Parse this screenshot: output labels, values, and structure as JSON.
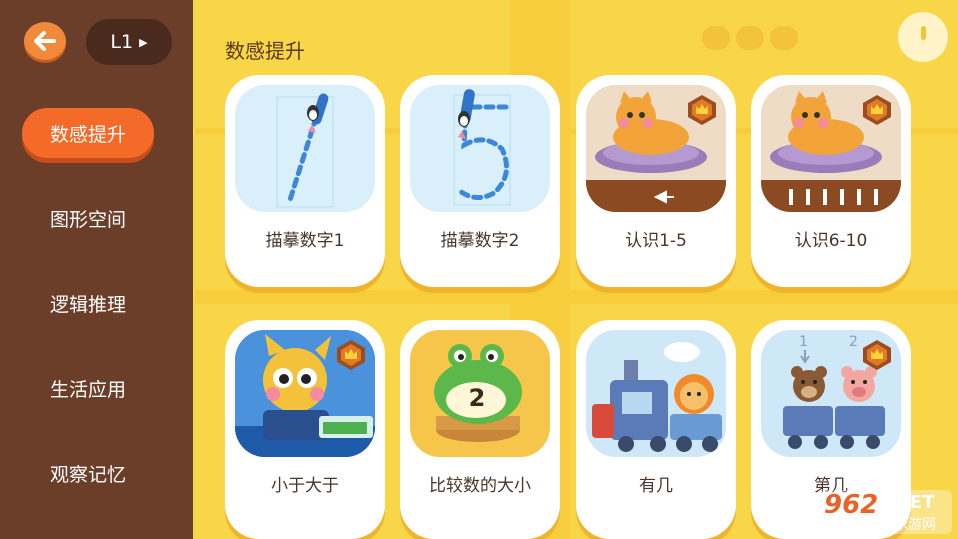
{
  "header": {
    "level_label": "L1",
    "section_title": "数感提升"
  },
  "sidebar": {
    "items": [
      {
        "label": "数感提升",
        "active": true
      },
      {
        "label": "图形空间",
        "active": false
      },
      {
        "label": "逻辑推理",
        "active": false
      },
      {
        "label": "生活应用",
        "active": false
      },
      {
        "label": "观察记忆",
        "active": false
      }
    ]
  },
  "lessons": [
    {
      "label": "描摹数字1",
      "icon": "trace-number-one-icon"
    },
    {
      "label": "描摹数字2",
      "icon": "trace-number-five-icon"
    },
    {
      "label": "认识1-5",
      "icon": "cat-fish-icon",
      "premium": true
    },
    {
      "label": "认识6-10",
      "icon": "cat-fish-icon",
      "premium": true
    },
    {
      "label": "小于大于",
      "icon": "fox-scale-icon",
      "premium": true
    },
    {
      "label": "比较数的大小",
      "icon": "frog-number-icon",
      "number": "2"
    },
    {
      "label": "有几",
      "icon": "train-lion-icon"
    },
    {
      "label": "第几",
      "icon": "train-bears-icon",
      "premium": true,
      "numbers": [
        "1",
        "2"
      ]
    }
  ],
  "watermark": {
    "number": "962",
    "suffix": ".NET",
    "text": "乐游网"
  },
  "colors": {
    "background": "#f9d548",
    "sidebar": "#6b3e2a",
    "accent": "#f46a29",
    "card": "#ffffff"
  }
}
